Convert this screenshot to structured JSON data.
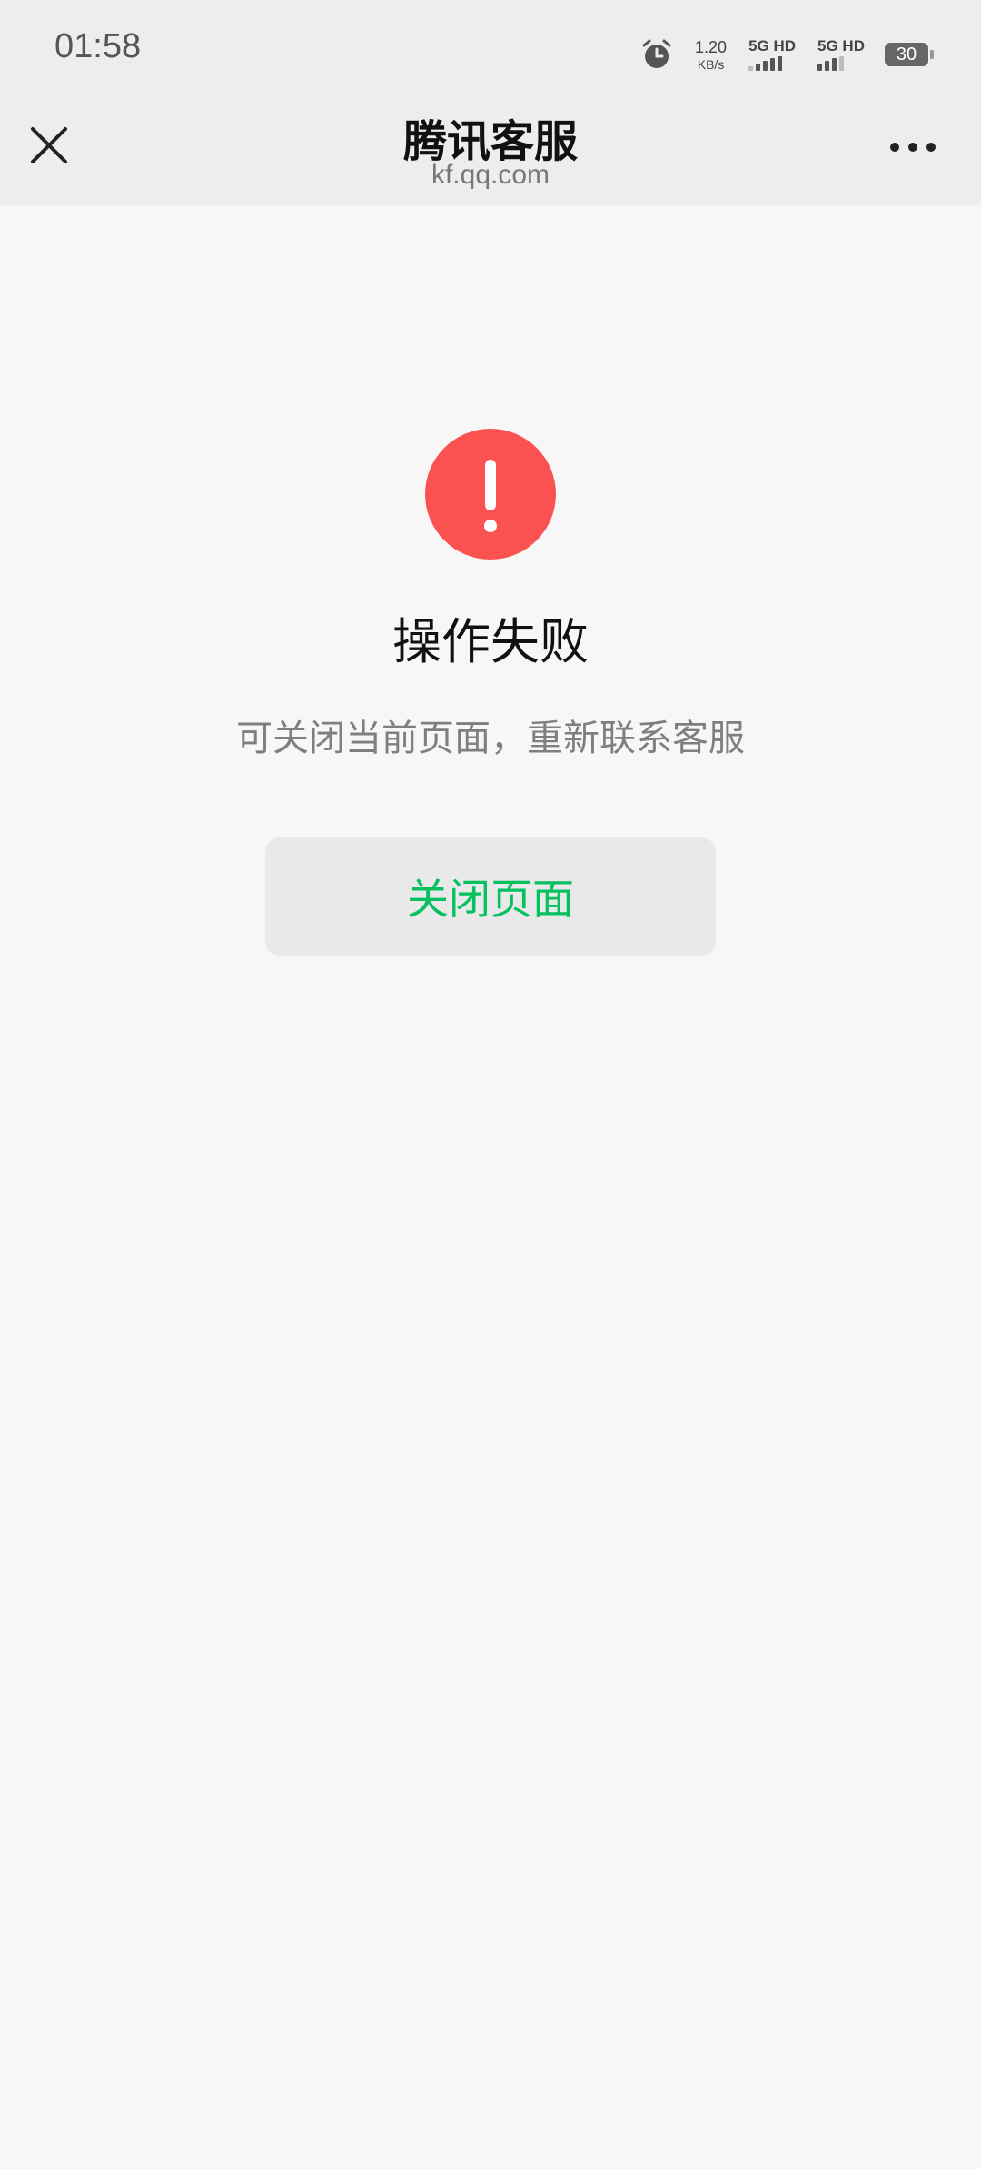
{
  "status_bar": {
    "time": "01:58",
    "net_speed_value": "1.20",
    "net_speed_unit": "KB/s",
    "sim1_label": "5G HD",
    "sim2_label": "5G HD",
    "battery_level": "30"
  },
  "nav": {
    "title": "腾讯客服",
    "subtitle": "kf.qq.com"
  },
  "result": {
    "title": "操作失败",
    "description": "可关闭当前页面，重新联系客服",
    "close_button_label": "关闭页面"
  },
  "colors": {
    "error": "#fa5151",
    "accent": "#07c160",
    "background": "#f7f7f7",
    "bar_background": "#ededed"
  },
  "icons": {
    "close": "close-icon",
    "more": "more-icon",
    "alarm": "alarm-icon",
    "error": "warning-icon"
  }
}
